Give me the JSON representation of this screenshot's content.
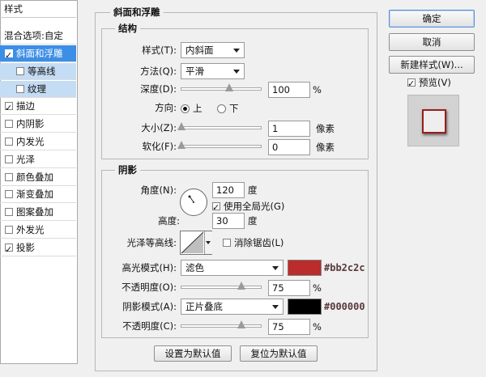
{
  "left_panel": {
    "header": "样式",
    "blend_options": "混合选项:自定",
    "items": [
      {
        "label": "斜面和浮雕",
        "checked": true,
        "selected": true,
        "sub": false
      },
      {
        "label": "等高线",
        "checked": false,
        "selected": false,
        "sub": true
      },
      {
        "label": "纹理",
        "checked": false,
        "selected": false,
        "sub": true
      },
      {
        "label": "描边",
        "checked": true,
        "selected": false,
        "sub": false
      },
      {
        "label": "内阴影",
        "checked": false,
        "selected": false,
        "sub": false
      },
      {
        "label": "内发光",
        "checked": false,
        "selected": false,
        "sub": false
      },
      {
        "label": "光泽",
        "checked": false,
        "selected": false,
        "sub": false
      },
      {
        "label": "颜色叠加",
        "checked": false,
        "selected": false,
        "sub": false
      },
      {
        "label": "渐变叠加",
        "checked": false,
        "selected": false,
        "sub": false
      },
      {
        "label": "图案叠加",
        "checked": false,
        "selected": false,
        "sub": false
      },
      {
        "label": "外发光",
        "checked": false,
        "selected": false,
        "sub": false
      },
      {
        "label": "投影",
        "checked": true,
        "selected": false,
        "sub": false
      }
    ]
  },
  "bevel": {
    "title": "斜面和浮雕",
    "structure": {
      "title": "结构",
      "style_label": "样式(T):",
      "style_value": "内斜面",
      "technique_label": "方法(Q):",
      "technique_value": "平滑",
      "depth_label": "深度(D):",
      "depth_value": "100",
      "depth_unit": "%",
      "depth_level": 0.6,
      "direction_label": "方向:",
      "direction_up": "上",
      "direction_down": "下",
      "size_label": "大小(Z):",
      "size_value": "1",
      "size_unit": "像素",
      "size_level": 0.0,
      "soften_label": "软化(F):",
      "soften_value": "0",
      "soften_unit": "像素",
      "soften_level": 0.0
    },
    "shading": {
      "title": "阴影",
      "angle_label": "角度(N):",
      "angle_value": "120",
      "angle_unit": "度",
      "global_light_label": "使用全局光(G)",
      "global_light_checked": true,
      "altitude_label": "高度:",
      "altitude_value": "30",
      "altitude_unit": "度",
      "gloss_label": "光泽等高线:",
      "anti_alias_label": "消除锯齿(L)",
      "anti_alias_checked": false,
      "highlight_mode_label": "高光模式(H):",
      "highlight_mode_value": "滤色",
      "highlight_color": "#bb2c2c",
      "highlight_hex": "#bb2c2c",
      "highlight_opacity_label": "不透明度(O):",
      "highlight_opacity_value": "75",
      "highlight_opacity_unit": "%",
      "highlight_opacity_level": 0.75,
      "shadow_mode_label": "阴影模式(A):",
      "shadow_mode_value": "正片叠底",
      "shadow_color": "#000000",
      "shadow_hex": "#000000",
      "shadow_opacity_label": "不透明度(C):",
      "shadow_opacity_value": "75",
      "shadow_opacity_unit": "%",
      "shadow_opacity_level": 0.75
    },
    "make_default": "设置为默认值",
    "reset_default": "复位为默认值"
  },
  "right": {
    "ok": "确定",
    "cancel": "取消",
    "new_style": "新建样式(W)...",
    "preview_label": "预览(V)",
    "preview_checked": true
  }
}
